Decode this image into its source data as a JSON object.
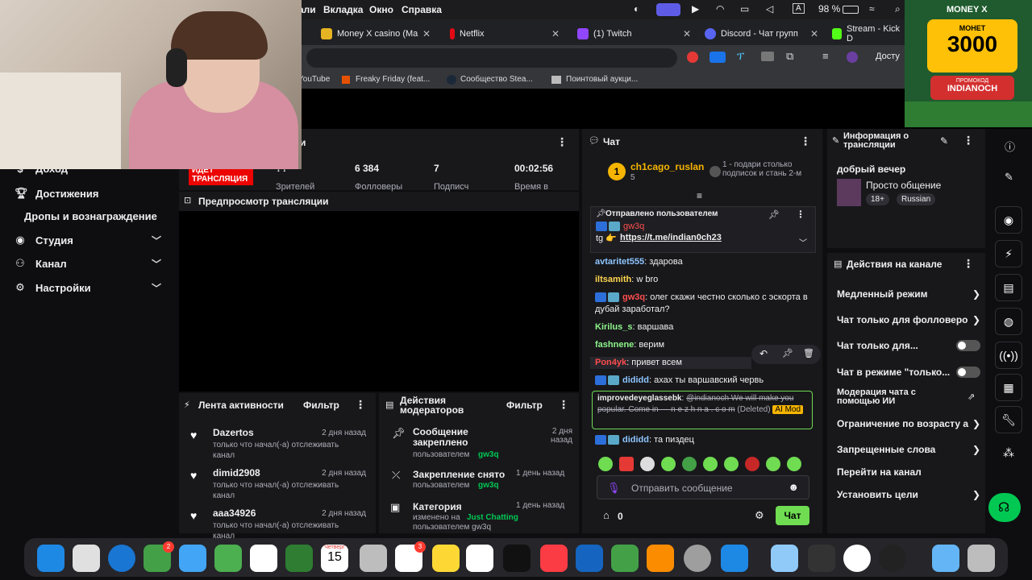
{
  "menubar": {
    "items": [
      "али",
      "Вкладка",
      "Окно",
      "Справка"
    ],
    "battery": "98 %"
  },
  "tabs": [
    {
      "label": "Money X casino (Ma",
      "color": "#e6b422"
    },
    {
      "label": "Netflix",
      "color": "#e50914"
    },
    {
      "label": "(1) Twitch",
      "color": "#9146ff"
    },
    {
      "label": "Discord - Чат групп",
      "color": "#5865f2"
    },
    {
      "label": "Stream - Kick D",
      "color": "#53fc18"
    }
  ],
  "toolbar": {
    "profile_label": "Досту"
  },
  "bookmarks": [
    "YouTube",
    "Freaky Friday (feat...",
    "Сообщество Stea...",
    "Поинтовый аукци..."
  ],
  "sidebar": {
    "items": [
      {
        "label": "Доход",
        "icon": "dollar-icon"
      },
      {
        "label": "Достижения",
        "icon": "trophy-icon"
      },
      {
        "label": "Дропы и вознаграждение",
        "icon": ""
      },
      {
        "label": "Студия",
        "icon": "camera-icon"
      },
      {
        "label": "Канал",
        "icon": "people-icon"
      },
      {
        "label": "Настройки",
        "icon": "gear-icon"
      }
    ]
  },
  "stats": {
    "title": "и",
    "live_badge": "ИДЕТ ТРАНСЛЯЦИЯ",
    "viewers_value": "??",
    "viewers_label": "Зрителей",
    "followers_value": "6 384",
    "followers_label": "Фолловеры",
    "subs_value": "7",
    "subs_label": "Подписч",
    "time_value": "00:02:56",
    "time_label": "Время в"
  },
  "preview": {
    "title": "Предпросмотр трансляции"
  },
  "activity": {
    "title": "Лента активности",
    "filter": "Фильтр",
    "items": [
      {
        "name": "Dazertos",
        "time": "2 дня назад",
        "desc": "только что начал(-а) отслеживать канал"
      },
      {
        "name": "dimid2908",
        "time": "2 дня назад",
        "desc": "только что начал(-а) отслеживать канал"
      },
      {
        "name": "aaa34926",
        "time": "2 дня назад",
        "desc": "только что начал(-а) отслеживать канал"
      }
    ]
  },
  "modactions": {
    "title": "Действия модераторов",
    "filter": "Фильтр",
    "items": [
      {
        "title": "Сообщение закреплено",
        "time": "2 дня назад",
        "by": "пользователем",
        "who": "gw3q"
      },
      {
        "title": "Закрепление снято",
        "time": "1 день назад",
        "by": "пользователем",
        "who": "gw3q"
      },
      {
        "title": "Категория",
        "time": "1 день назад",
        "by": "изменено на",
        "who": "Just Chatting",
        "extra": "пользователем gw3q"
      }
    ]
  },
  "chat": {
    "title": "Чат",
    "top_user": "ch1cago_ruslan",
    "top_count": "5",
    "top_rank": "1",
    "gift_text": "1 - подари столько подписок и стань 2-м",
    "pinned_label": "Отправлено пользователем",
    "pinned_user": "gw3q",
    "pinned_text": "tg 👉",
    "pinned_link": "https://t.me/indian0ch23",
    "messages": [
      {
        "user": "avtaritet555",
        "color": "#8ec5ff",
        "text": "здарова"
      },
      {
        "user": "iltsamith",
        "color": "#ffd54f",
        "text": "w bro"
      },
      {
        "user": "gw3q",
        "color": "#ff4d4d",
        "text": "олег скажи честно сколько с эскорта в дубай заработал?"
      },
      {
        "user": "Kirilus_s",
        "color": "#8ef58a",
        "text": "варшава"
      },
      {
        "user": "fashnene",
        "color": "#8ef58a",
        "text": "верим"
      },
      {
        "user": "Pon4yk",
        "color": "#ff4d4d",
        "text": "привет всем"
      },
      {
        "user": "dididd",
        "color": "#8ec5ff",
        "text": "ахах ты варшавский червь"
      },
      {
        "user": "improvedeyeglassebk",
        "color": "#efeff1",
        "text": "@indianoch We will make you popular. Come in — n e z h n a . c o m"
      },
      {
        "user": "dididd",
        "color": "#8ec5ff",
        "text": "та пиздец"
      }
    ],
    "deleted_label": "(Deleted)",
    "aimod_label": "AI Mod",
    "input_placeholder": "Отправить сообщение",
    "points": "0",
    "send_label": "Чат"
  },
  "info": {
    "title": "Информация о трансляции",
    "stream_title": "добрый вечер",
    "category": "Просто общение",
    "tag_age": "18+",
    "tag_lang": "Russian"
  },
  "actions": {
    "title": "Действия на канале",
    "items": [
      {
        "label": "Медленный режим",
        "kind": "arrow"
      },
      {
        "label": "Чат только для фолловеро",
        "kind": "arrow"
      },
      {
        "label": "Чат только для...",
        "kind": "toggle"
      },
      {
        "label": "Чат в режиме \"только...",
        "kind": "toggle"
      },
      {
        "label": "Модерация чата с помощью ИИ",
        "kind": "ext"
      },
      {
        "label": "Ограничение по возрасту а",
        "kind": "arrow"
      },
      {
        "label": "Запрещенные слова",
        "kind": "arrow"
      },
      {
        "label": "Перейти на канал",
        "kind": "none"
      },
      {
        "label": "Установить цели",
        "kind": "arrow"
      }
    ]
  },
  "promo": {
    "brand": "MONEY X",
    "label_top": "МОНЕТ",
    "amount": "3000",
    "code_label": "ПРОМОКОД",
    "code": "INDIANOCH"
  },
  "dock": {
    "calendar_month": "Четверг",
    "calendar_day": "15",
    "badge1": "2",
    "badge2": "3"
  }
}
